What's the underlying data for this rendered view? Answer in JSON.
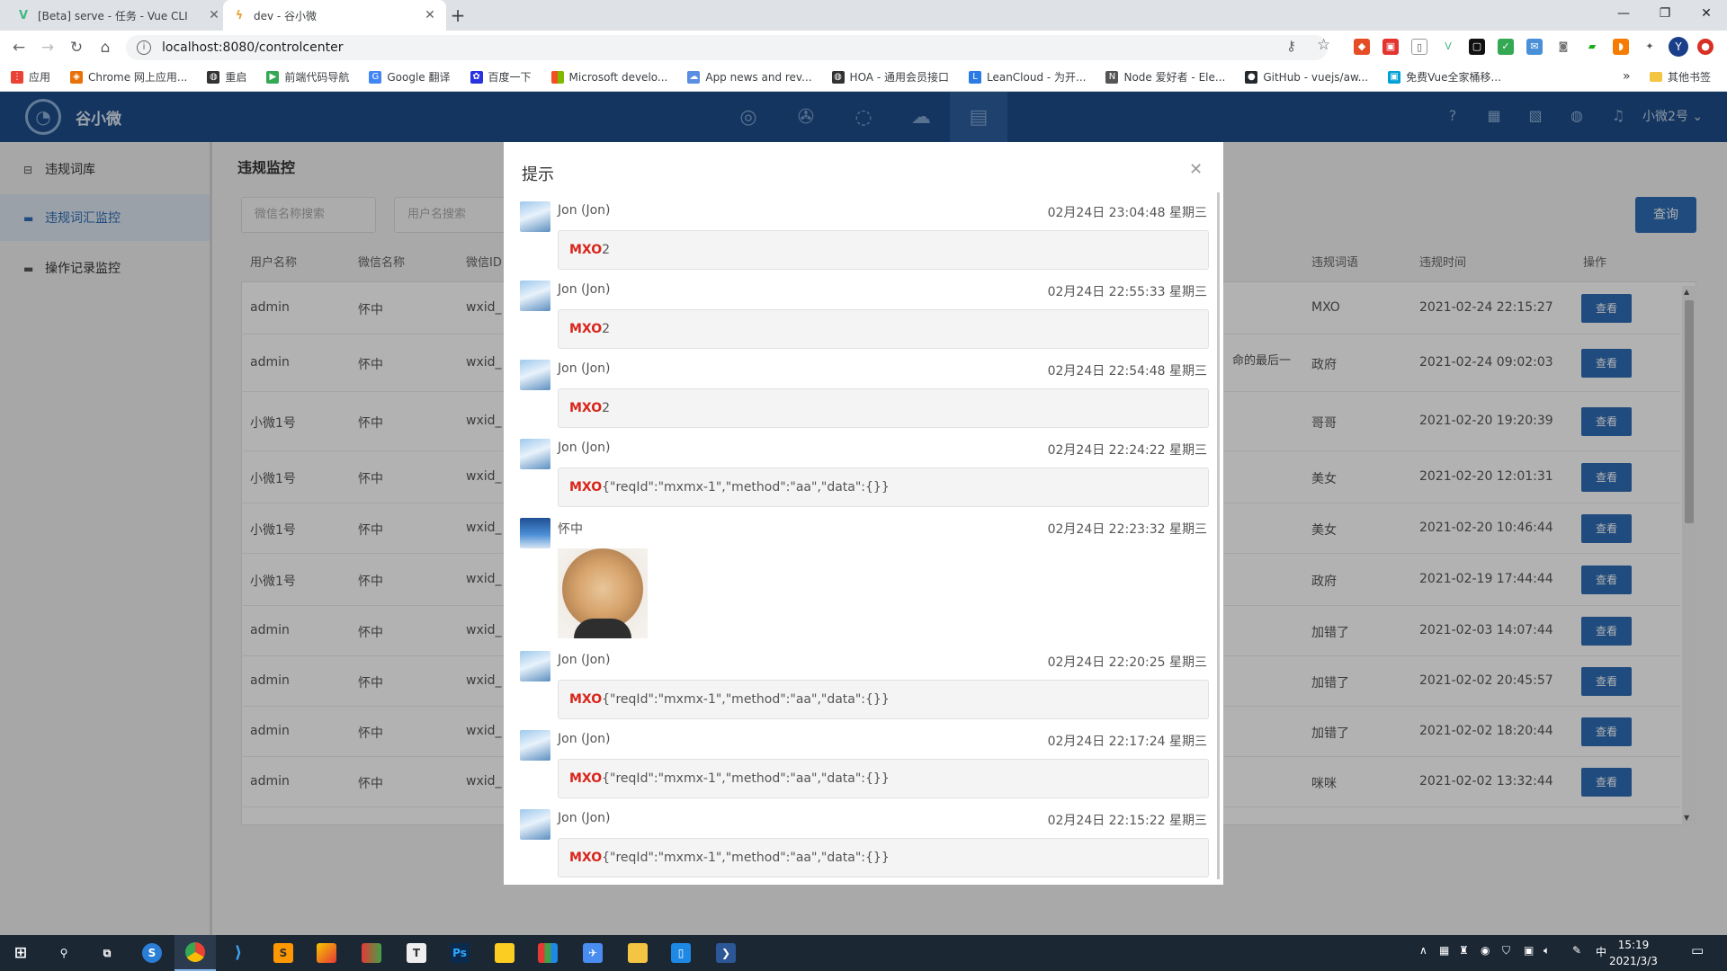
{
  "browser": {
    "tabs": [
      {
        "title": "[Beta] serve - 任务 - Vue CLI",
        "favicon": "vue-icon"
      },
      {
        "title": "dev - 谷小微",
        "favicon": "bolt-icon"
      }
    ],
    "url": "localhost:8080/controlcenter",
    "bookmarks": [
      "应用",
      "Chrome 网上应用...",
      "重启",
      "前端代码导航",
      "Google 翻译",
      "百度一下",
      "Microsoft develo...",
      "App news and rev...",
      "HOA - 通用会员接口",
      "LeanCloud - 为开...",
      "Node 爱好者 - Ele...",
      "GitHub - vuejs/aw...",
      "免费Vue全家桶移..."
    ],
    "other_bookmarks": "其他书签",
    "profile_initial": "Y"
  },
  "app": {
    "brand": "谷小微",
    "user": "小微2号",
    "sidebar": [
      {
        "label": "违规词库"
      },
      {
        "label": "违规词汇监控"
      },
      {
        "label": "操作记录监控"
      }
    ],
    "page_title": "违规监控",
    "search": {
      "wechat_placeholder": "微信名称搜索",
      "user_placeholder": "用户名搜索",
      "query_button": "查询"
    },
    "table": {
      "headers": [
        "用户名称",
        "微信名称",
        "微信ID",
        "违规词语",
        "违规时间",
        "操作"
      ],
      "partial_text": "命的最后一",
      "rows": [
        {
          "user": "admin",
          "wechat": "怀中",
          "wxid": "wxid_",
          "word": "MXO",
          "time": "2021-02-24 22:15:27",
          "action": "查看"
        },
        {
          "user": "admin",
          "wechat": "怀中",
          "wxid": "wxid_",
          "word": "政府",
          "time": "2021-02-24 09:02:03",
          "action": "查看"
        },
        {
          "user": "小微1号",
          "wechat": "怀中",
          "wxid": "wxid_",
          "word": "哥哥",
          "time": "2021-02-20 19:20:39",
          "action": "查看"
        },
        {
          "user": "小微1号",
          "wechat": "怀中",
          "wxid": "wxid_",
          "word": "美女",
          "time": "2021-02-20 12:01:31",
          "action": "查看"
        },
        {
          "user": "小微1号",
          "wechat": "怀中",
          "wxid": "wxid_",
          "word": "美女",
          "time": "2021-02-20 10:46:44",
          "action": "查看"
        },
        {
          "user": "小微1号",
          "wechat": "怀中",
          "wxid": "wxid_",
          "word": "政府",
          "time": "2021-02-19 17:44:44",
          "action": "查看"
        },
        {
          "user": "admin",
          "wechat": "怀中",
          "wxid": "wxid_",
          "word": "加错了",
          "time": "2021-02-03 14:07:44",
          "action": "查看"
        },
        {
          "user": "admin",
          "wechat": "怀中",
          "wxid": "wxid_",
          "word": "加错了",
          "time": "2021-02-02 20:45:57",
          "action": "查看"
        },
        {
          "user": "admin",
          "wechat": "怀中",
          "wxid": "wxid_",
          "word": "加错了",
          "time": "2021-02-02 18:20:44",
          "action": "查看"
        },
        {
          "user": "admin",
          "wechat": "怀中",
          "wxid": "wxid_",
          "word": "咪咪",
          "time": "2021-02-02 13:32:44",
          "action": "查看"
        }
      ]
    }
  },
  "dialog": {
    "title": "提示",
    "messages": [
      {
        "sender": "Jon (Jon)",
        "time": "02月24日 23:04:48 星期三",
        "keyword": "MXO",
        "rest": "2"
      },
      {
        "sender": "Jon (Jon)",
        "time": "02月24日 22:55:33 星期三",
        "keyword": "MXO",
        "rest": "2"
      },
      {
        "sender": "Jon (Jon)",
        "time": "02月24日 22:54:48 星期三",
        "keyword": "MXO",
        "rest": "2"
      },
      {
        "sender": "Jon (Jon)",
        "time": "02月24日 22:24:22 星期三",
        "keyword": "MXO",
        "rest": "{\"reqId\":\"mxmx-1\",\"method\":\"aa\",\"data\":{}}"
      },
      {
        "sender": "怀中",
        "time": "02月24日 22:23:32 星期三",
        "image": "cat-photo"
      },
      {
        "sender": "Jon (Jon)",
        "time": "02月24日 22:20:25 星期三",
        "keyword": "MXO",
        "rest": "{\"reqId\":\"mxmx-1\",\"method\":\"aa\",\"data\":{}}"
      },
      {
        "sender": "Jon (Jon)",
        "time": "02月24日 22:17:24 星期三",
        "keyword": "MXO",
        "rest": "{\"reqId\":\"mxmx-1\",\"method\":\"aa\",\"data\":{}}"
      },
      {
        "sender": "Jon (Jon)",
        "time": "02月24日 22:15:22 星期三",
        "keyword": "MXO",
        "rest": "{\"reqId\":\"mxmx-1\",\"method\":\"aa\",\"data\":{}}"
      }
    ]
  },
  "taskbar": {
    "time": "15:19",
    "date": "2021/3/3",
    "ime": "中"
  },
  "colors": {
    "header": "#1d4d8a",
    "accent": "#2d6cb5",
    "keyword": "#d9261c"
  }
}
